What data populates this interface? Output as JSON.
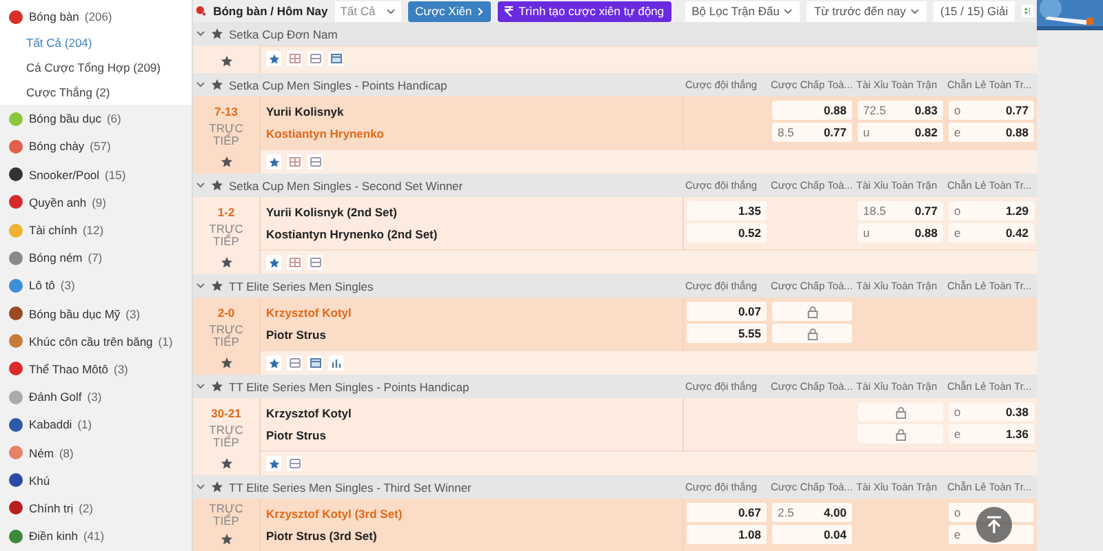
{
  "sidebar": {
    "groups": [
      {
        "label": "Bóng bàn",
        "count": "(206)",
        "color": "#d9302a",
        "expanded": true,
        "children": [
          {
            "label": "Tất Cả",
            "count": "(204)",
            "selected": true
          },
          {
            "label": "Cá Cược Tổng Hợp",
            "count": "(209)",
            "selected": false
          },
          {
            "label": "Cược Thắng",
            "count": "(2)",
            "selected": false
          }
        ]
      },
      {
        "label": "Bóng bầu dục",
        "count": "(6)",
        "color": "#8cc63f",
        "expanded": false
      },
      {
        "label": "Bóng chày",
        "count": "(57)",
        "color": "#e0604a",
        "expanded": false
      },
      {
        "label": "Snooker/Pool",
        "count": "(15)",
        "color": "#333333",
        "expanded": false
      },
      {
        "label": "Quyền anh",
        "count": "(9)",
        "color": "#d42a2a",
        "expanded": false
      },
      {
        "label": "Tài chính",
        "count": "(12)",
        "color": "#f0b030",
        "expanded": false
      },
      {
        "label": "Bóng ném",
        "count": "(7)",
        "color": "#8a8a8a",
        "expanded": false
      },
      {
        "label": "Lô tô",
        "count": "(3)",
        "color": "#3c8fd8",
        "expanded": false
      },
      {
        "label": "Bóng bầu dục Mỹ",
        "count": "(3)",
        "color": "#9a4a22",
        "expanded": false
      },
      {
        "label": "Khúc côn cầu trên băng",
        "count": "(1)",
        "color": "#c87a3a",
        "expanded": false
      },
      {
        "label": "Thể Thao Môtô",
        "count": "(3)",
        "color": "#d92a2a",
        "expanded": false
      },
      {
        "label": "Đánh Golf",
        "count": "(3)",
        "color": "#aaaaaa",
        "expanded": false
      },
      {
        "label": "Kabaddi",
        "count": "(1)",
        "color": "#2a5aa8",
        "expanded": false
      },
      {
        "label": "Ném",
        "count": "(8)",
        "color": "#e8806a",
        "expanded": false
      },
      {
        "label": "Khú",
        "color": "#2a4aa8",
        "expanded": false
      },
      {
        "label": "Chính trị",
        "count": "(2)",
        "color": "#b82020",
        "expanded": false
      },
      {
        "label": "Điền kinh",
        "count": "(41)",
        "color": "#3a8a3a",
        "expanded": false
      }
    ]
  },
  "toolbar": {
    "breadcrumb": "Bóng bàn / Hôm Nay",
    "select": "Tất Cả",
    "parlay_button": "Cược Xiên",
    "builder_button": "Trình tạo cược xiên tự động",
    "filters": [
      "Bộ Lọc Trận Đấu",
      "Từ trước đến nay"
    ],
    "league_count": "(15 / 15) Giải"
  },
  "leagues": [
    {
      "name": "Setka Cup Đơn Nam",
      "matches": [
        {
          "highlighted": false,
          "icons": [
            {
              "kind": "favorite"
            },
            {
              "kind": "scoreboard"
            },
            {
              "kind": "ticket"
            },
            {
              "kind": "calendar"
            }
          ]
        }
      ]
    },
    {
      "name": "Setka Cup Men Singles - Points Handicap",
      "columns": [
        "Cược đội thắng",
        "Cược Chấp Toà...",
        "Tài Xỉu Toàn Trận",
        "Chẵn Lẻ Toàn Tr..."
      ],
      "matches": [
        {
          "score": "7-13",
          "live": "TRỰC TIẾP",
          "highlighted": true,
          "teams": [
            {
              "name": "Yurii Kolisnyk",
              "favored": false
            },
            {
              "name": "Kostiantyn Hrynenko",
              "favored": true
            }
          ],
          "handicap": [
            {
              "kind": "price",
              "price": "0.88"
            },
            {
              "kind": "price",
              "line": "8.5",
              "price": "0.77"
            }
          ],
          "total": [
            {
              "kind": "price",
              "line": "72.5",
              "price": "0.83"
            },
            {
              "kind": "price",
              "line": "u",
              "price": "0.82"
            }
          ],
          "parity": [
            {
              "kind": "price",
              "line": "o",
              "price": "0.77"
            },
            {
              "kind": "price",
              "line": "e",
              "price": "0.88"
            }
          ],
          "icons": [
            {
              "kind": "favorite"
            },
            {
              "kind": "scoreboard"
            },
            {
              "kind": "ticket"
            }
          ]
        }
      ]
    },
    {
      "name": "Setka Cup Men Singles - Second Set Winner",
      "columns": [
        "Cược đội thắng",
        "Cược Chấp Toà...",
        "Tài Xỉu Toàn Trận",
        "Chẵn Lẻ Toàn Tr..."
      ],
      "matches": [
        {
          "score": "1-2",
          "live": "TRỰC TIẾP",
          "highlighted": false,
          "teams": [
            {
              "name": "Yurii Kolisnyk (2nd Set)",
              "favored": false
            },
            {
              "name": "Kostiantyn Hrynenko (2nd Set)",
              "favored": false
            }
          ],
          "win": [
            {
              "kind": "price",
              "price": "1.35"
            },
            {
              "kind": "price",
              "price": "0.52"
            }
          ],
          "total": [
            {
              "kind": "price",
              "line": "18.5",
              "price": "0.77"
            },
            {
              "kind": "price",
              "line": "u",
              "price": "0.88"
            }
          ],
          "parity": [
            {
              "kind": "price",
              "line": "o",
              "price": "1.29"
            },
            {
              "kind": "price",
              "line": "e",
              "price": "0.42"
            }
          ],
          "icons": [
            {
              "kind": "favorite"
            },
            {
              "kind": "scoreboard"
            },
            {
              "kind": "ticket"
            }
          ]
        }
      ]
    },
    {
      "name": "TT Elite Series Men Singles",
      "columns": [
        "Cược đội thắng",
        "Cược Chấp Toà...",
        "Tài Xỉu Toàn Trận",
        "Chẵn Lẻ Toàn Tr..."
      ],
      "matches": [
        {
          "score": "2-0",
          "live": "TRỰC TIẾP",
          "highlighted": true,
          "teams": [
            {
              "name": "Krzysztof Kotyl",
              "favored": true
            },
            {
              "name": "Piotr Strus",
              "favored": false
            }
          ],
          "win": [
            {
              "kind": "price",
              "price": "0.07"
            },
            {
              "kind": "price",
              "price": "5.55"
            }
          ],
          "handicap": [
            {
              "kind": "locked"
            },
            {
              "kind": "locked"
            }
          ],
          "icons": [
            {
              "kind": "favorite"
            },
            {
              "kind": "ticket"
            },
            {
              "kind": "calendar"
            },
            {
              "kind": "chart"
            }
          ]
        }
      ]
    },
    {
      "name": "TT Elite Series Men Singles - Points Handicap",
      "columns": [
        "Cược đội thắng",
        "Cược Chấp Toà...",
        "Tài Xỉu Toàn Trận",
        "Chẵn Lẻ Toàn Tr..."
      ],
      "matches": [
        {
          "score": "30-21",
          "live": "TRỰC TIẾP",
          "highlighted": false,
          "teams": [
            {
              "name": "Krzysztof Kotyl",
              "favored": false
            },
            {
              "name": "Piotr Strus",
              "favored": false
            }
          ],
          "total": [
            {
              "kind": "locked"
            },
            {
              "kind": "locked"
            }
          ],
          "parity": [
            {
              "kind": "price",
              "line": "o",
              "price": "0.38"
            },
            {
              "kind": "price",
              "line": "e",
              "price": "1.36"
            }
          ],
          "icons": [
            {
              "kind": "favorite"
            },
            {
              "kind": "ticket"
            }
          ]
        }
      ]
    },
    {
      "name": "TT Elite Series Men Singles - Third Set Winner",
      "columns": [
        "Cược đội thắng",
        "Cược Chấp Toà...",
        "Tài Xỉu Toàn Trận",
        "Chẵn Lẻ Toàn Tr..."
      ],
      "matches": [
        {
          "live": "TRỰC TIẾP",
          "highlighted": true,
          "teams": [
            {
              "name": "Krzysztof Kotyl (3rd Set)",
              "favored": true
            },
            {
              "name": "Piotr Strus (3rd Set)",
              "favored": false
            }
          ],
          "win": [
            {
              "kind": "price",
              "price": "0.67"
            },
            {
              "kind": "price",
              "price": "1.08"
            }
          ],
          "handicap": [
            {
              "kind": "price",
              "line": "2.5",
              "price": "4.00"
            },
            {
              "kind": "price",
              "price": "0.04"
            }
          ],
          "parity": [
            {
              "kind": "price",
              "line": "o"
            },
            {
              "kind": "price",
              "line": "e"
            }
          ]
        }
      ]
    }
  ]
}
